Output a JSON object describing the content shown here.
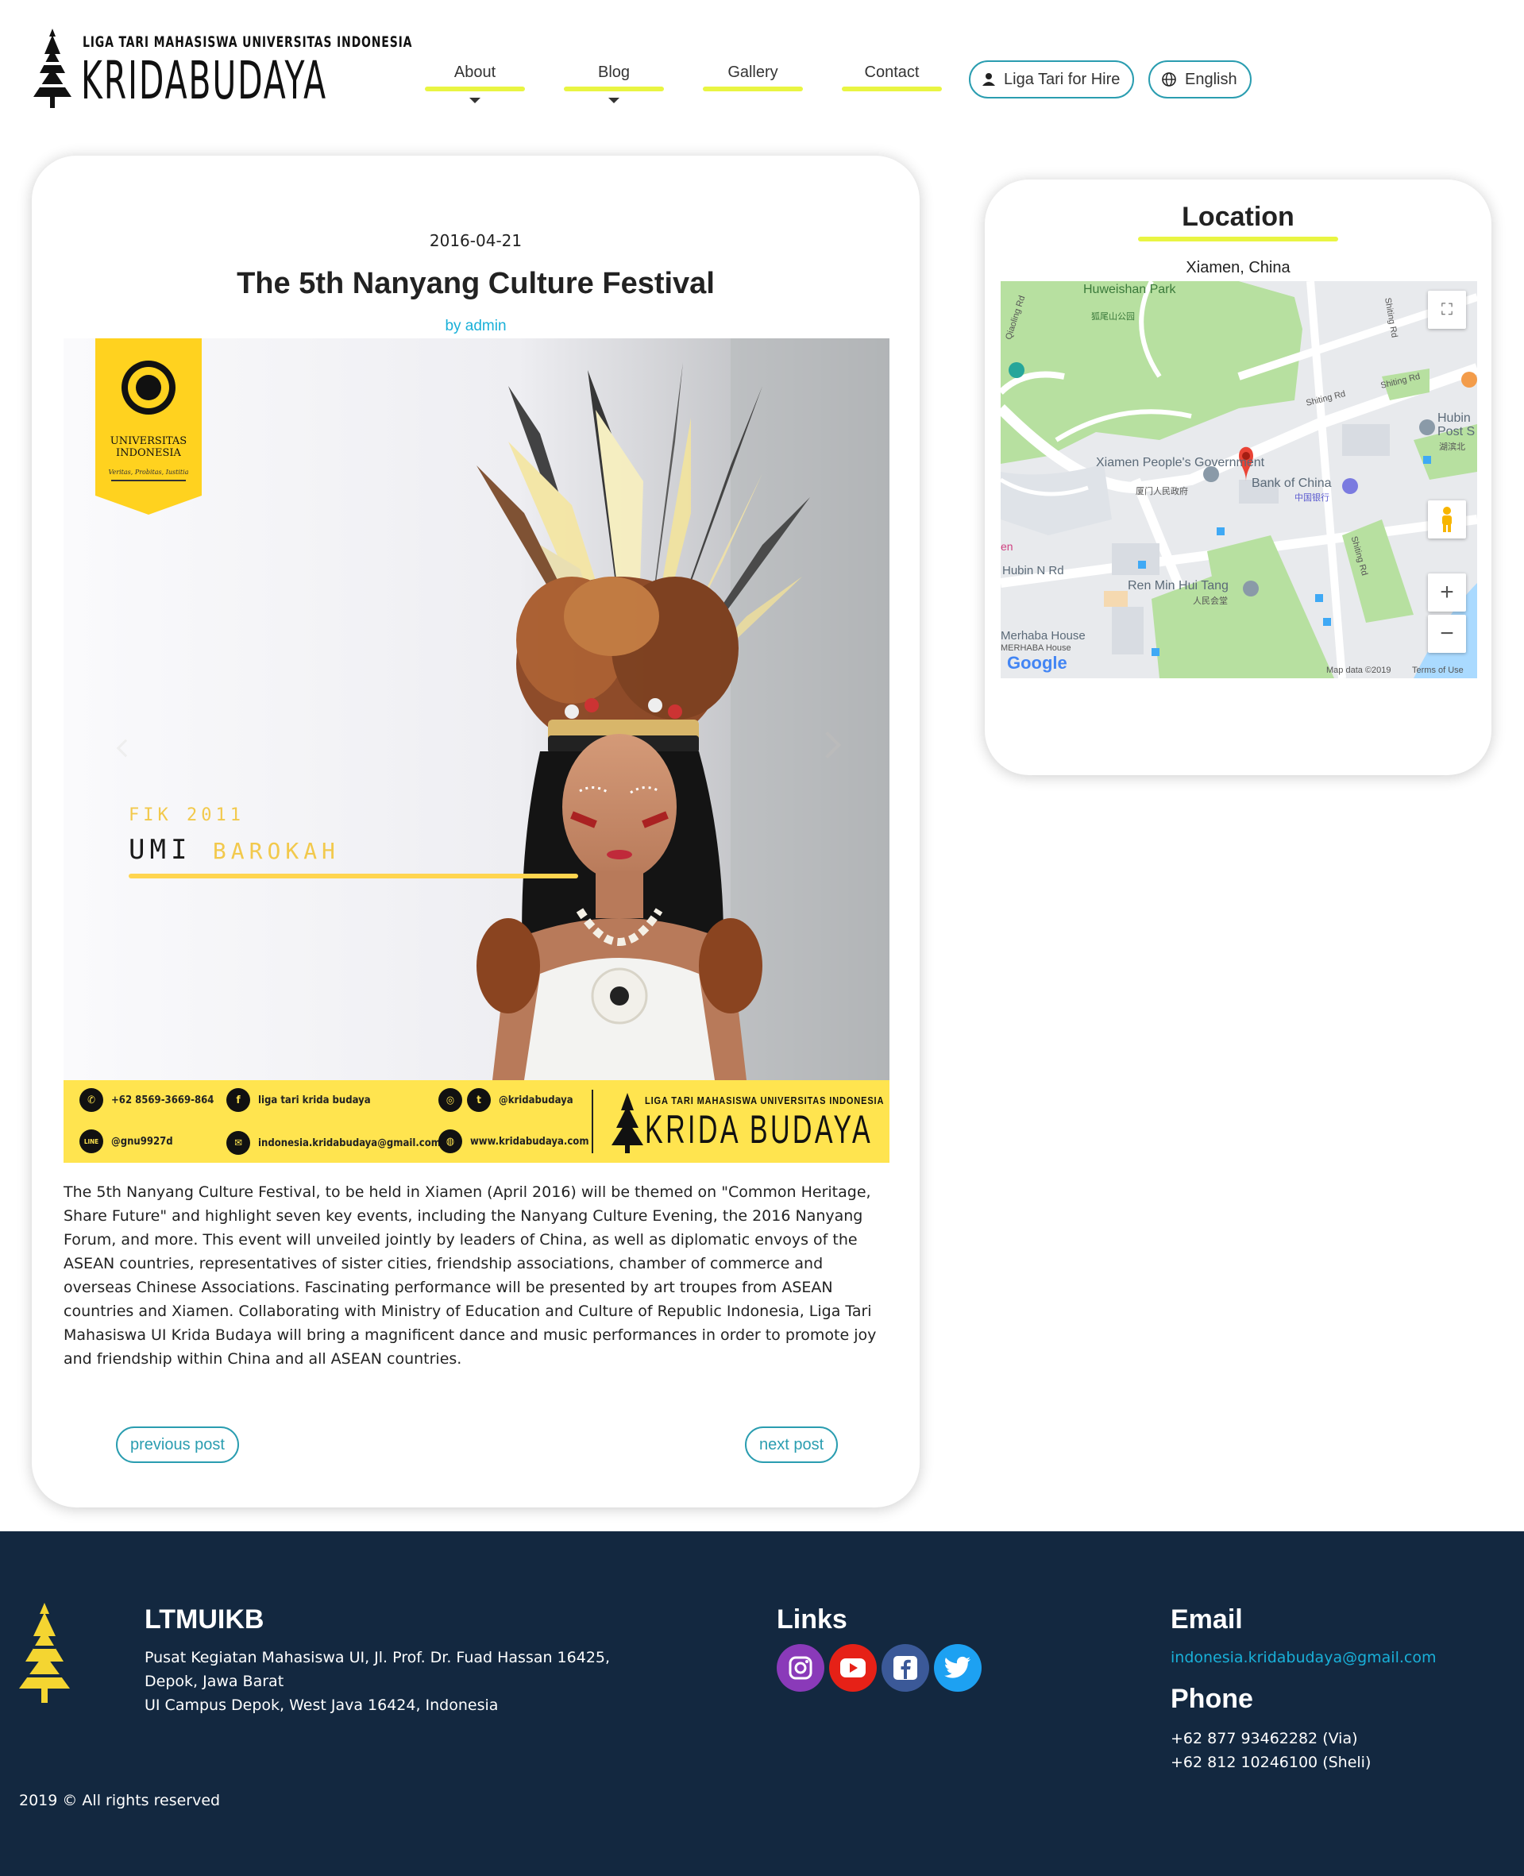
{
  "header": {
    "logo_small": "LIGA TARI MAHASISWA UNIVERSITAS INDONESIA",
    "logo_big": "KRIDABUDAYA",
    "nav": [
      {
        "label": "About",
        "has_dropdown": true
      },
      {
        "label": "Blog",
        "has_dropdown": true
      },
      {
        "label": "Gallery",
        "has_dropdown": false
      },
      {
        "label": "Contact",
        "has_dropdown": false
      }
    ],
    "hire_label": "Liga Tari for Hire",
    "language_label": "English",
    "accent_color": "#e9f542"
  },
  "post": {
    "date": "2016-04-21",
    "title": "The 5th Nanyang Culture Festival",
    "author": "by admin",
    "image": {
      "university_name": "UNIVERSITAS INDONESIA",
      "university_motto": "Veritas, Probitas, Iustitia",
      "faculty_year": "FIK 2011",
      "first_name": "UMI",
      "last_name": "BAROKAH",
      "contacts": {
        "phone": "+62 8569-3669-864",
        "facebook": "liga tari krida budaya",
        "instagram_twitter": "@kridabudaya",
        "line": "@gnu9927d",
        "email": "indonesia.kridabudaya@gmail.com",
        "website": "www.kridabudaya.com",
        "line_icon_text": "LINE"
      },
      "strip_logo_small": "LIGA TARI MAHASISWA UNIVERSITAS INDONESIA",
      "strip_logo_big": "KRIDA BUDAYA"
    },
    "body": "The 5th Nanyang Culture Festival, to be held in Xiamen (April 2016) will be themed on \"Common Heritage, Share Future\" and highlight seven key events, including the Nanyang Culture Evening, the 2016 Nanyang Forum, and more. This event will unveiled jointly by leaders of China, as well as diplomatic envoys of the ASEAN countries, representatives of sister cities, friendship associations, chamber of commerce and overseas Chinese Associations. Fascinating performance will be presented by art troupes from ASEAN countries and Xiamen. Collaborating with Ministry of Education and Culture of Republic Indonesia, Liga Tari Mahasiswa UI Krida Budaya will bring a magnificent dance and music performances in order to promote joy and friendship within China and all ASEAN countries.",
    "previous_label": "previous post",
    "next_label": "next post"
  },
  "location": {
    "title": "Location",
    "city": "Xiamen, China",
    "map": {
      "labels": {
        "park": "Huweishan Park",
        "park_cn": "狐尾山公园",
        "gov": "Xiamen People's Government",
        "gov_cn": "厦门人民政府",
        "bank": "Bank of China",
        "bank_cn": "中国银行",
        "hall": "Ren Min Hui Tang",
        "hall_cn": "人民会堂",
        "road1": "Hubin N Rd",
        "road2": "Shiting Rd",
        "road3": "Shiting Rd",
        "road4": "Shiting Rd",
        "road5": "Shiting Rd",
        "road6": "Qiaoling Rd",
        "post": "Hubin Post S",
        "post_cn": "湖滨北",
        "merhaba": "Merhaba House",
        "merhaba2": "MERHABA House",
        "en": "en",
        "google": "Google",
        "map_data": "Map data ©2019",
        "terms": "Terms of Use"
      },
      "zoom_in": "+",
      "zoom_out": "−"
    }
  },
  "footer": {
    "org_title": "LTMUIKB",
    "address_lines": [
      "Pusat Kegiatan Mahasiswa UI, Jl. Prof. Dr. Fuad Hassan 16425,",
      "Depok, Jawa Barat",
      "UI Campus Depok, West Java 16424, Indonesia"
    ],
    "links_title": "Links",
    "social": [
      {
        "name": "instagram",
        "color": "#8a3ab9"
      },
      {
        "name": "youtube",
        "color": "#e62117"
      },
      {
        "name": "facebook",
        "color": "#3b5998"
      },
      {
        "name": "twitter",
        "color": "#1da1f2"
      }
    ],
    "email_title": "Email",
    "email": "indonesia.kridabudaya@gmail.com",
    "phone_title": "Phone",
    "phones": [
      "+62 877 93462282 (Via)",
      "+62 812 10246100 (Sheli)"
    ],
    "copyright": "2019 © All rights reserved"
  }
}
